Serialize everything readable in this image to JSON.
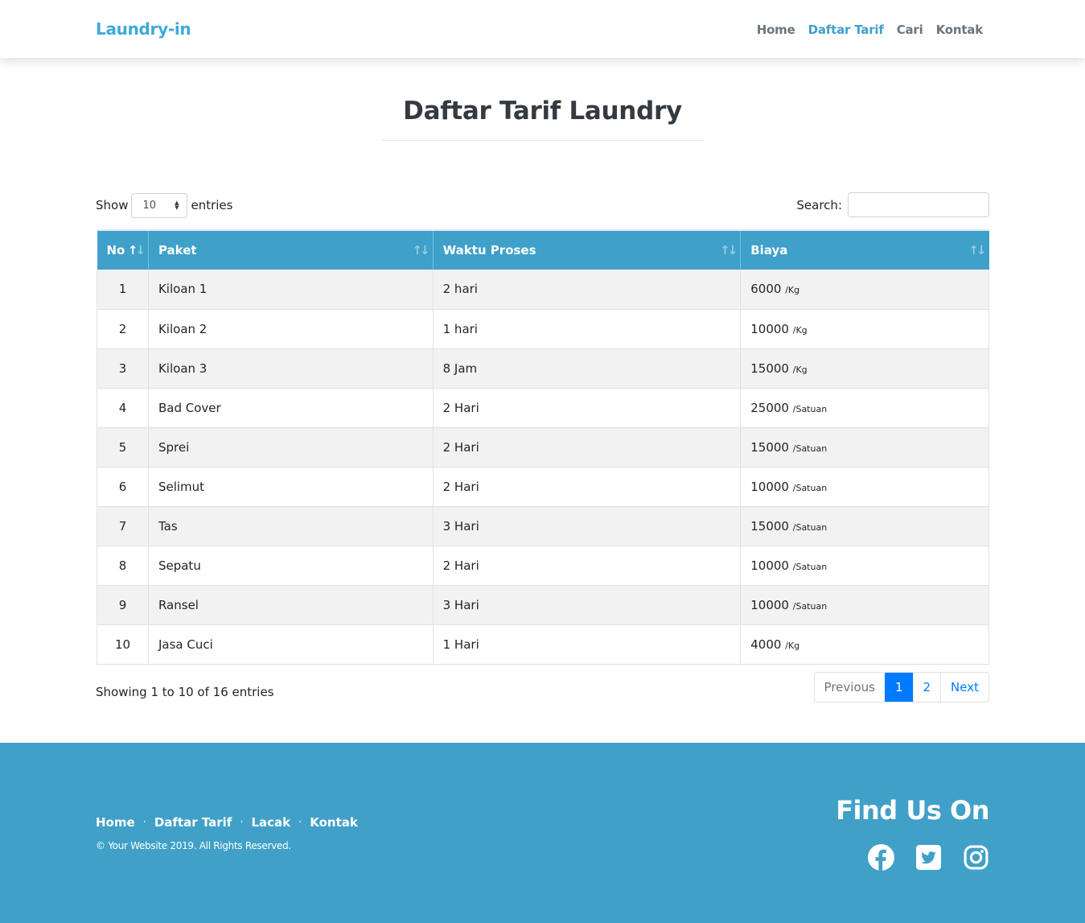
{
  "navbar": {
    "brand": "Laundry-in",
    "links": [
      "Home",
      "Daftar Tarif",
      "Cari",
      "Kontak"
    ],
    "active": "Daftar Tarif"
  },
  "page": {
    "title": "Daftar Tarif Laundry"
  },
  "controls": {
    "show_label": "Show",
    "entries_select_value": "10",
    "entries_label": "entries",
    "search_label": "Search:",
    "search_value": ""
  },
  "table": {
    "columns": [
      "No",
      "Paket",
      "Waktu Proses",
      "Biaya"
    ],
    "rows": [
      {
        "no": "1",
        "paket": "Kiloan 1",
        "waktu": "2 hari",
        "biaya": "6000",
        "unit": "/Kg"
      },
      {
        "no": "2",
        "paket": "Kiloan 2",
        "waktu": "1 hari",
        "biaya": "10000",
        "unit": "/Kg"
      },
      {
        "no": "3",
        "paket": "Kiloan 3",
        "waktu": "8 Jam",
        "biaya": "15000",
        "unit": "/Kg"
      },
      {
        "no": "4",
        "paket": "Bad Cover",
        "waktu": "2 Hari",
        "biaya": "25000",
        "unit": "/Satuan"
      },
      {
        "no": "5",
        "paket": "Sprei",
        "waktu": "2 Hari",
        "biaya": "15000",
        "unit": "/Satuan"
      },
      {
        "no": "6",
        "paket": "Selimut",
        "waktu": "2 Hari",
        "biaya": "10000",
        "unit": "/Satuan"
      },
      {
        "no": "7",
        "paket": "Tas",
        "waktu": "3 Hari",
        "biaya": "15000",
        "unit": "/Satuan"
      },
      {
        "no": "8",
        "paket": "Sepatu",
        "waktu": "2 Hari",
        "biaya": "10000",
        "unit": "/Satuan"
      },
      {
        "no": "9",
        "paket": "Ransel",
        "waktu": "3 Hari",
        "biaya": "10000",
        "unit": "/Satuan"
      },
      {
        "no": "10",
        "paket": "Jasa Cuci",
        "waktu": "1 Hari",
        "biaya": "4000",
        "unit": "/Kg"
      }
    ]
  },
  "info": "Showing 1 to 10 of 16 entries",
  "pagination": {
    "previous": "Previous",
    "pages": [
      "1",
      "2"
    ],
    "current": "1",
    "next": "Next"
  },
  "footer": {
    "links": [
      "Home",
      "Daftar Tarif",
      "Lacak",
      "Kontak"
    ],
    "separator": "·",
    "copyright": "© Your Website 2019. All Rights Reserved.",
    "find_us": "Find Us On",
    "social_icons": [
      "facebook-icon",
      "twitter-icon",
      "instagram-icon"
    ]
  },
  "colors": {
    "brand": "#3fa9d9",
    "table_header": "#3fa0c9",
    "footer": "#40a0c8",
    "pagination_active": "#007bff"
  }
}
